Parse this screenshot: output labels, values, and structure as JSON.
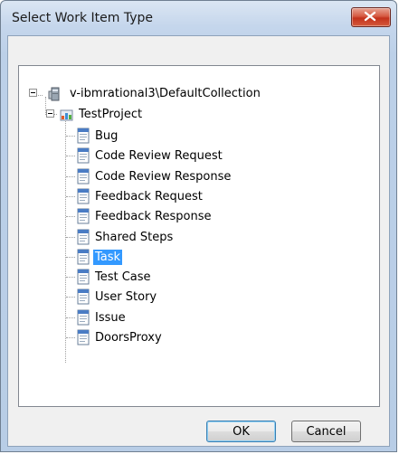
{
  "window": {
    "title": "Select Work Item Type"
  },
  "tree": {
    "root": {
      "label": "v-ibmrational3\\DefaultCollection",
      "icon": "server-icon"
    },
    "project": {
      "label": "TestProject",
      "icon": "team-project-icon"
    },
    "items": [
      {
        "label": "Bug"
      },
      {
        "label": "Code Review Request"
      },
      {
        "label": "Code Review Response"
      },
      {
        "label": "Feedback Request"
      },
      {
        "label": "Feedback Response"
      },
      {
        "label": "Shared Steps"
      },
      {
        "label": "Task",
        "selected": true
      },
      {
        "label": "Test Case"
      },
      {
        "label": "User Story"
      },
      {
        "label": "Issue"
      },
      {
        "label": "DoorsProxy"
      }
    ]
  },
  "buttons": {
    "ok": "OK",
    "cancel": "Cancel"
  },
  "colors": {
    "selection": "#3399ff",
    "close": "#c3321c"
  }
}
